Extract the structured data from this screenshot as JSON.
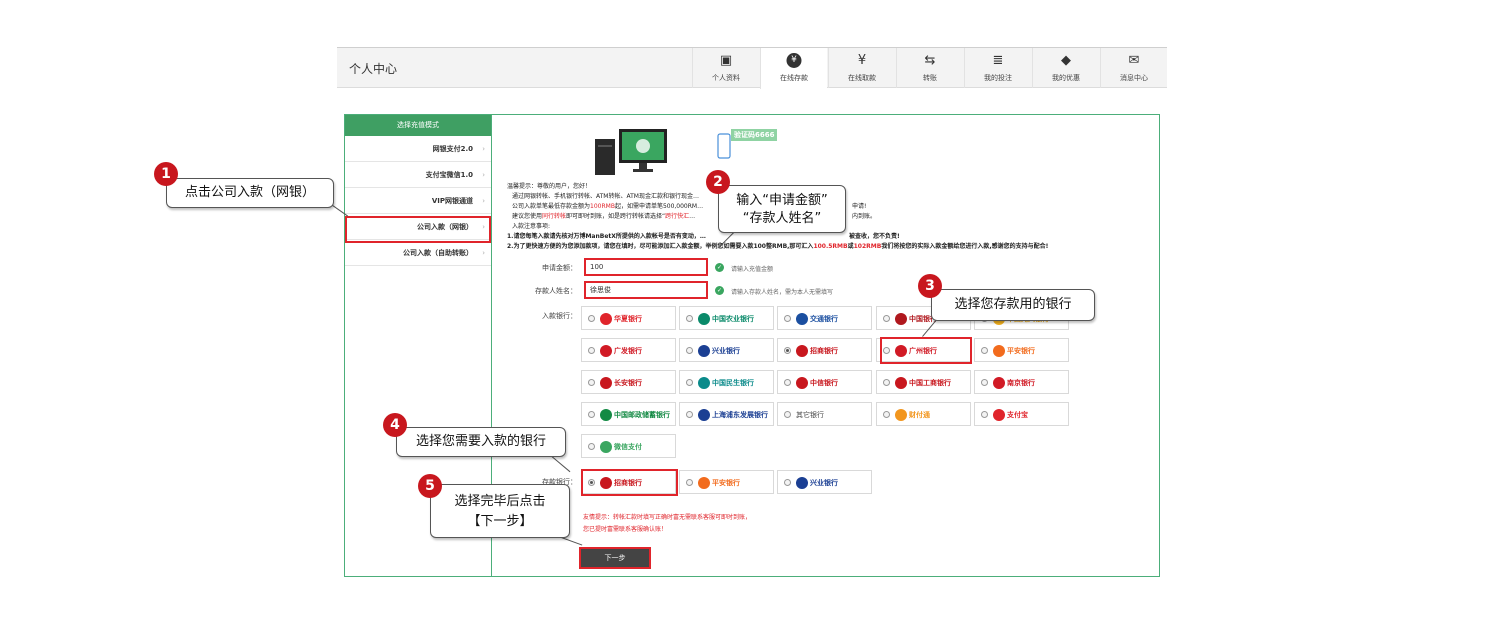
{
  "header": {
    "title": "个人中心"
  },
  "nav": [
    {
      "label": "个人资料",
      "icon": "id-card-icon"
    },
    {
      "label": "在线存款",
      "icon": "yen-coin-icon"
    },
    {
      "label": "在线取款",
      "icon": "cash-out-icon"
    },
    {
      "label": "转账",
      "icon": "transfer-arrows-icon"
    },
    {
      "label": "我的投注",
      "icon": "bet-list-icon"
    },
    {
      "label": "我的优惠",
      "icon": "tag-icon"
    },
    {
      "label": "消息中心",
      "icon": "envelope-icon"
    }
  ],
  "active_nav": 1,
  "sidebar": {
    "heading": "选择充值模式",
    "items": [
      {
        "label": "网银支付2.0"
      },
      {
        "label": "支付宝微信1.0"
      },
      {
        "label": "VIP网银通道"
      },
      {
        "label": "公司入款（网银）"
      },
      {
        "label": "公司入款（自助转账）"
      }
    ]
  },
  "verify_badge": "验证码6666",
  "notes": {
    "l1": "温馨提示：尊敬的用户，您好！",
    "l2": "通过网银转帐、手机银行转帐、ATM转帐、ATM现金汇款和银行现金…",
    "l3a": "公司入款单笔最低存款金额为",
    "l3b": "100RMB",
    "l3c": "起，如需申请单笔500,000RM…",
    "l3d": "申请!",
    "l4a": "建议您使用",
    "l4b": "同行转帐",
    "l4c": "即可即时到账，如是跨行转帐请选择“",
    "l4d": "跨行快汇",
    "l4e": "…",
    "l4f": "内到账。",
    "l5": "入款注意事项:",
    "l6a": "1.请您每笔入款请先核对万博ManBetX所提供的入款帐号是否有变动，…",
    "l6b": "被查收，您不负责!",
    "l7a": "2.为了更快速方便的为您添加款项，请您在填时，尽可能添加汇入款金额，举例您如需要入款100整RMB,那可汇入",
    "l7b": "100.5RMB",
    "l7c": "或",
    "l7d": "102RMB",
    "l7e": "我们将按您的实际入款金额给您进行入款,感谢您的支持与配合!"
  },
  "form": {
    "amount_label": "申请金额：",
    "amount_value": "100",
    "amount_hint": "请输入充值金额",
    "name_label": "存款人姓名：",
    "name_value": "徐思俊",
    "name_hint": "请输入存款人姓名，需为本人无需填写",
    "bank_label": "入款银行：",
    "receive_label": "存款银行："
  },
  "banks": [
    {
      "name": "华夏银行",
      "color": "#e0242b",
      "selected": false
    },
    {
      "name": "中国农业银行",
      "color": "#0a8a6a",
      "selected": false
    },
    {
      "name": "交通银行",
      "color": "#1b4fa0",
      "selected": false
    },
    {
      "name": "中国银行",
      "color": "#b0181e",
      "selected": false
    },
    {
      "name": "中国光大银行",
      "color": "#f2b01e",
      "selected": false
    },
    {
      "name": "广发银行",
      "color": "#d11a25",
      "selected": false
    },
    {
      "name": "兴业银行",
      "color": "#1b3f93",
      "selected": false
    },
    {
      "name": "招商银行",
      "color": "#c8171e",
      "selected": true
    },
    {
      "name": "广州银行",
      "color": "#d11a25",
      "selected": false
    },
    {
      "name": "平安银行",
      "color": "#f26b1d",
      "selected": false
    },
    {
      "name": "长安银行",
      "color": "#c8171e",
      "selected": false
    },
    {
      "name": "中国民生银行",
      "color": "#0a8a8a",
      "selected": false
    },
    {
      "name": "中信银行",
      "color": "#c8171e",
      "selected": false
    },
    {
      "name": "中国工商银行",
      "color": "#c8171e",
      "selected": false
    },
    {
      "name": "南京银行",
      "color": "#d11a25",
      "selected": false
    },
    {
      "name": "中国邮政储蓄银行",
      "color": "#138a44",
      "selected": false
    },
    {
      "name": "上海浦东发展银行",
      "color": "#1b3f93",
      "selected": false
    },
    {
      "name": "其它银行",
      "color": "#ffffff",
      "selected": false
    },
    {
      "name": "财付通",
      "color": "#f2961e",
      "selected": false
    },
    {
      "name": "支付宝",
      "color": "#e0242b",
      "selected": false
    },
    {
      "name": "微信支付",
      "color": "#3aa660",
      "selected": false
    }
  ],
  "receive_banks": [
    {
      "name": "招商银行",
      "color": "#c8171e",
      "selected": true
    },
    {
      "name": "平安银行",
      "color": "#f26b1d",
      "selected": false
    },
    {
      "name": "兴业银行",
      "color": "#1b3f93",
      "selected": false
    }
  ],
  "warn1": "友情提示：转帐汇款时填写正确时富无需联系客服可即时到账，",
  "warn2": "您已提时富需联系客服确认账！",
  "next_button": "下一步",
  "callouts": {
    "c1": "点击公司入款（网银）",
    "c2a": "输入“申请金额”",
    "c2b": "“存款人姓名”",
    "c3": "选择您存款用的银行",
    "c4": "选择您需要入款的银行",
    "c5a": "选择完毕后点击",
    "c5b": "【下一步】"
  },
  "badges": [
    "1",
    "2",
    "3",
    "4",
    "5"
  ]
}
